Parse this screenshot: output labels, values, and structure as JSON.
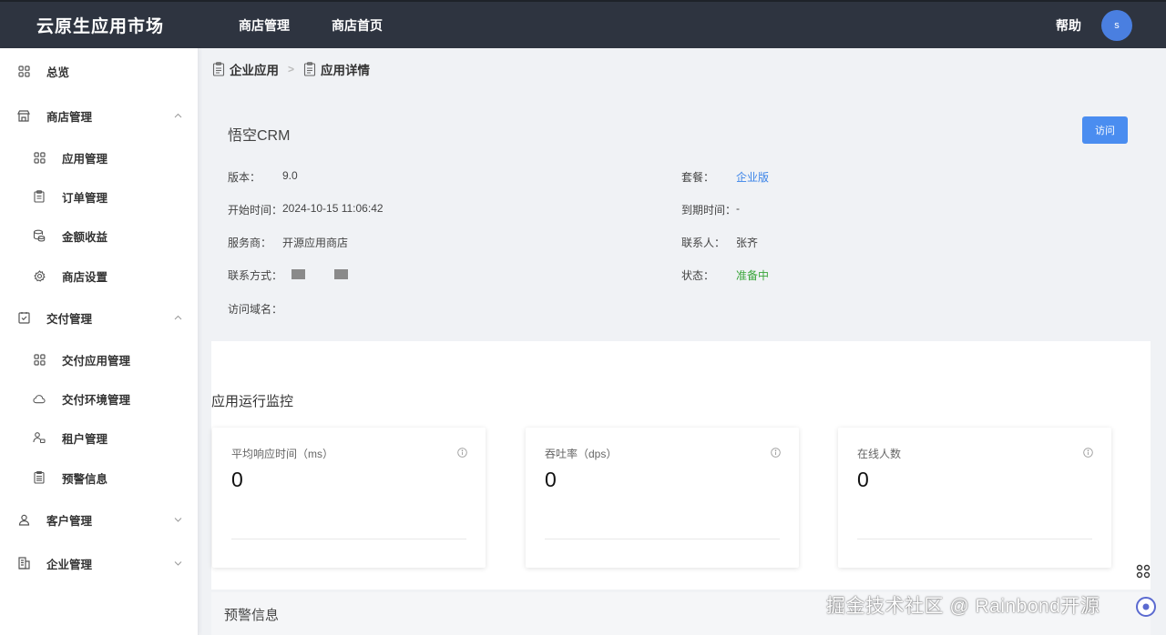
{
  "header": {
    "brand": "云原生应用市场",
    "nav": [
      "商店管理",
      "商店首页"
    ],
    "help": "帮助",
    "avatar_letter": "s"
  },
  "sidebar": {
    "items": [
      {
        "label": "总览",
        "icon": "grid-icon",
        "level": "top"
      },
      {
        "label": "商店管理",
        "icon": "store-icon",
        "level": "top",
        "expanded": true
      },
      {
        "label": "应用管理",
        "icon": "grid-icon",
        "level": "sub"
      },
      {
        "label": "订单管理",
        "icon": "clipboard-icon",
        "level": "sub"
      },
      {
        "label": "金额收益",
        "icon": "coins-icon",
        "level": "sub"
      },
      {
        "label": "商店设置",
        "icon": "gear-icon",
        "level": "sub"
      },
      {
        "label": "交付管理",
        "icon": "checklist-icon",
        "level": "top",
        "expanded": true
      },
      {
        "label": "交付应用管理",
        "icon": "grid-icon",
        "level": "sub"
      },
      {
        "label": "交付环境管理",
        "icon": "cloud-icon",
        "level": "sub"
      },
      {
        "label": "租户管理",
        "icon": "tenant-icon",
        "level": "sub"
      },
      {
        "label": "预警信息",
        "icon": "alert-doc-icon",
        "level": "sub"
      },
      {
        "label": "客户管理",
        "icon": "user-icon",
        "level": "top",
        "expanded": false
      },
      {
        "label": "企业管理",
        "icon": "building-icon",
        "level": "top",
        "expanded": false
      }
    ]
  },
  "breadcrumb": [
    "企业应用",
    "应用详情"
  ],
  "app": {
    "title": "悟空CRM",
    "visit_label": "访问",
    "fields_left": [
      {
        "label": "版本：",
        "value": "9.0"
      },
      {
        "label": "开始时间：",
        "value": "2024-10-15 11:06:42"
      },
      {
        "label": "服务商：",
        "value": "开源应用商店"
      },
      {
        "label": "联系方式：",
        "value": ""
      },
      {
        "label": "访问域名：",
        "value": ""
      }
    ],
    "fields_right": [
      {
        "label": "套餐：",
        "value": "企业版",
        "style": "link"
      },
      {
        "label": "到期时间：",
        "value": "-",
        "style": ""
      },
      {
        "label": "联系人：",
        "value": "张齐",
        "style": ""
      },
      {
        "label": "状态：",
        "value": "准备中",
        "style": "ok"
      }
    ]
  },
  "monitor": {
    "title": "应用运行监控",
    "cards": [
      {
        "label": "平均响应时间（ms）",
        "value": "0"
      },
      {
        "label": "吞吐率（dps）",
        "value": "0"
      },
      {
        "label": "在线人数",
        "value": "0"
      }
    ]
  },
  "alerts": {
    "title": "预警信息"
  },
  "watermark": "掘金技术社区 @ Rainbond开源",
  "colors": {
    "topbar": "#2e3440",
    "primary": "#4a8df0",
    "link": "#3a83e8",
    "success": "#3aa53a"
  }
}
